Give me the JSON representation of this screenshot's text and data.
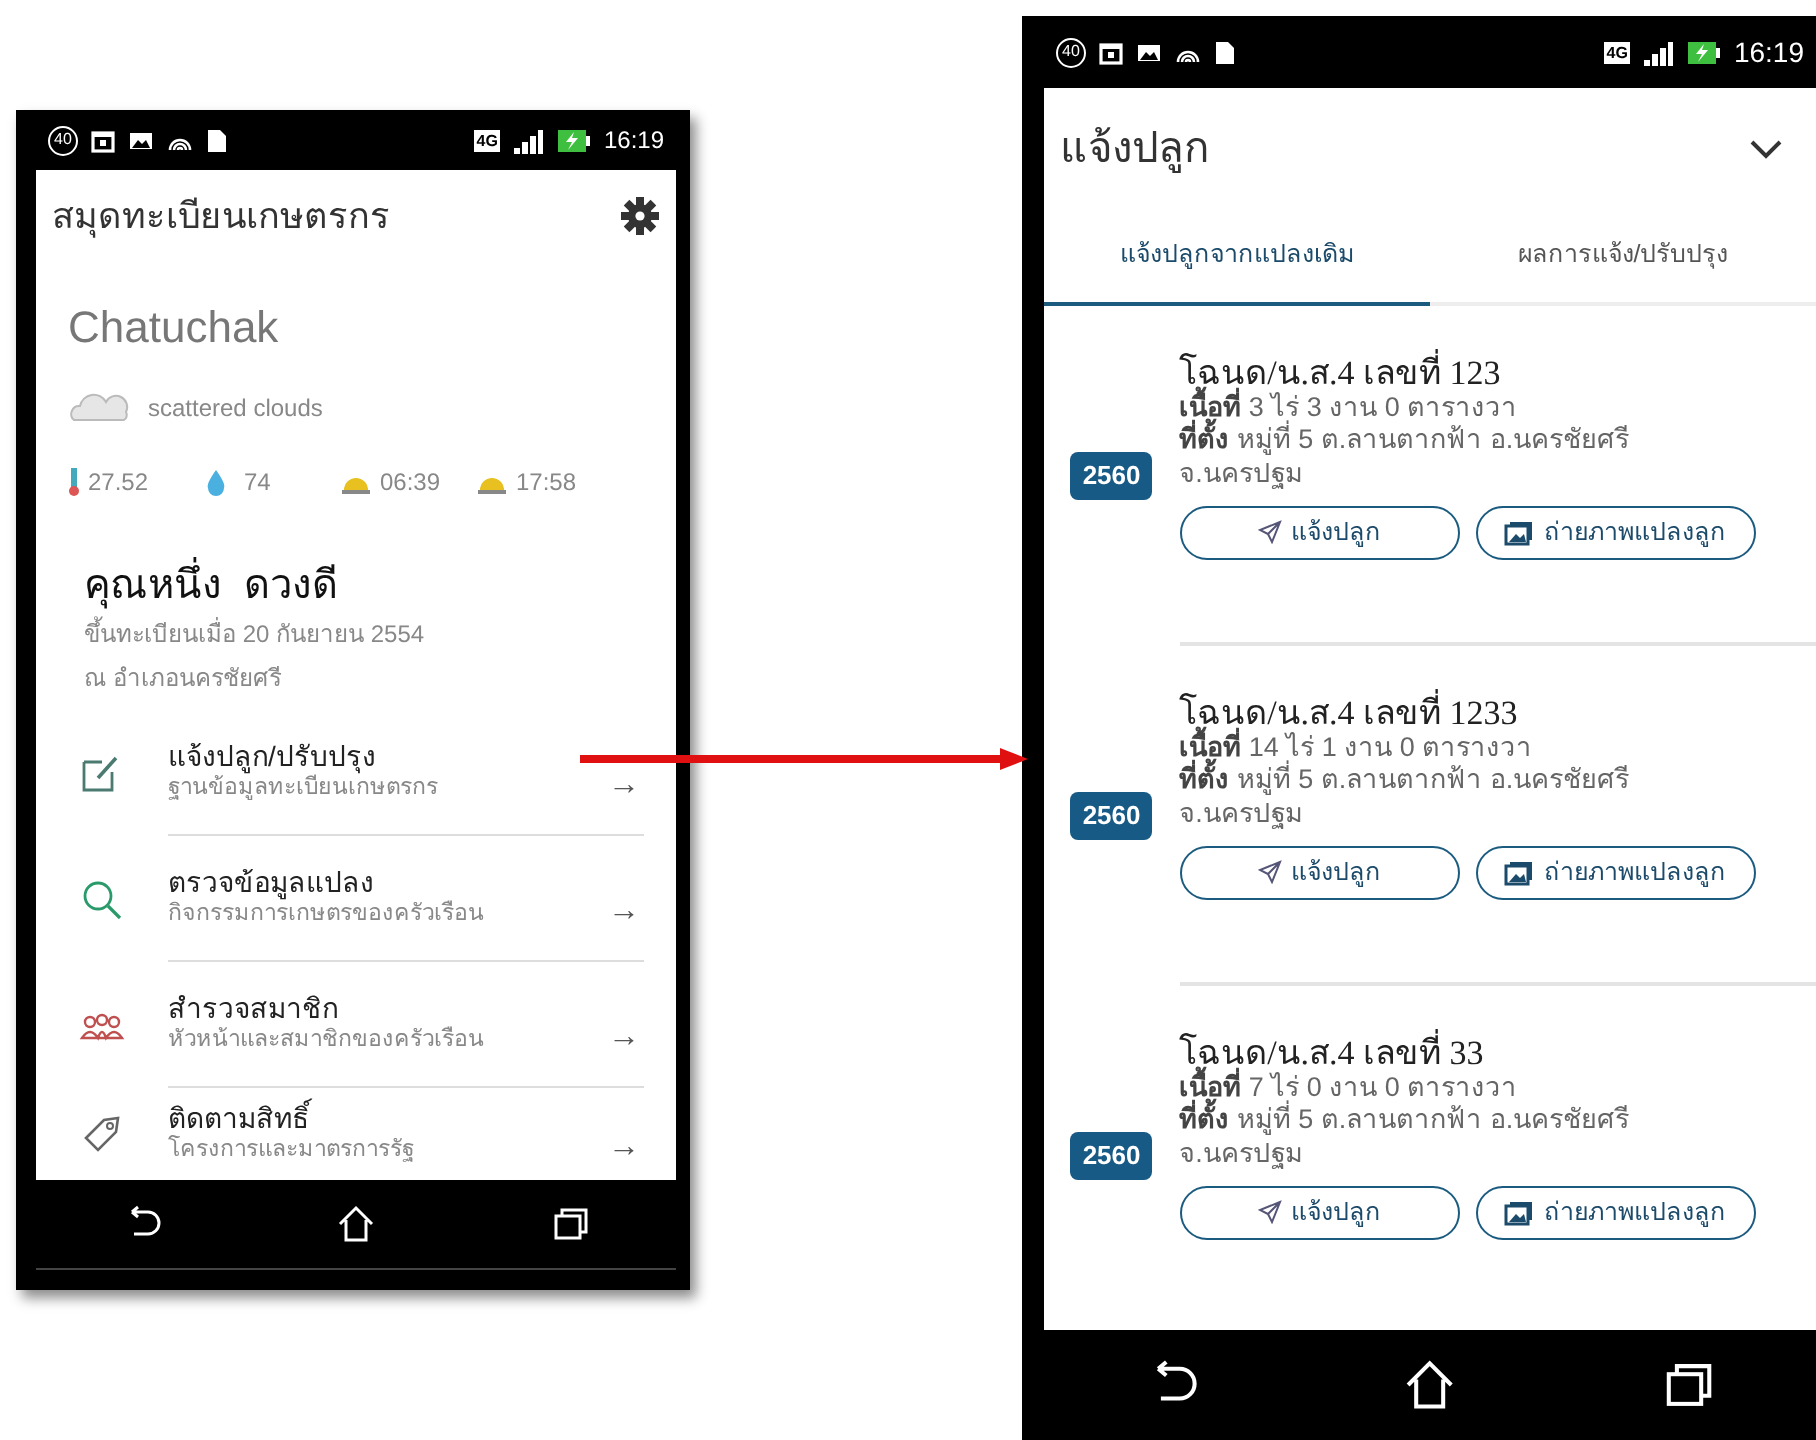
{
  "home_screen": {
    "status_bar": {
      "notification_count": "40",
      "network": "4G",
      "time": "16:19"
    },
    "app_bar": {
      "title": "สมุดทะเบียนเกษตรกร"
    },
    "weather": {
      "city": "Chatuchak",
      "condition": "scattered clouds",
      "stats": [
        {
          "kind": "temperature",
          "value": "27.52"
        },
        {
          "kind": "humidity",
          "value": "74"
        },
        {
          "kind": "sunrise",
          "value": "06:39"
        },
        {
          "kind": "sunset",
          "value": "17:58"
        }
      ]
    },
    "profile": {
      "name": "คุณหนึ่ง  ดวงดี",
      "registered": "ขึ้นทะเบียนเมื่อ 20 กันยายน 2554",
      "district": "ณ อำเภอนครชัยศรี"
    },
    "menu": [
      {
        "kind": "edit",
        "title": "แจ้งปลูก/ปรับปรุง",
        "subtitle": "ฐานข้อมูลทะเบียนเกษตรกร",
        "arrow": "→"
      },
      {
        "kind": "search",
        "title": "ตรวจข้อมูลแปลง",
        "subtitle": "กิจกรรมการเกษตรของครัวเรือน",
        "arrow": "→"
      },
      {
        "kind": "people",
        "title": "สำรวจสมาชิก",
        "subtitle": "หัวหน้าและสมาชิกของครัวเรือน",
        "arrow": "→"
      },
      {
        "kind": "tag",
        "title": "ติดตามสิทธิ์",
        "subtitle": "โครงการและมาตรการรัฐ",
        "arrow": "→"
      }
    ]
  },
  "planting_screen": {
    "status_bar": {
      "notification_count": "40",
      "network": "4G",
      "time": "16:19"
    },
    "app_bar": {
      "title": "แจ้งปลูก"
    },
    "tabs": [
      {
        "label": "แจ้งปลูกจากแปลงเดิม",
        "selected": true
      },
      {
        "label": "ผลการแจ้ง/ปรับปรุง",
        "selected": false
      }
    ],
    "plots": [
      {
        "title": "โฉนด/น.ส.4 เลขที่ 123",
        "area": "**เนื้อที่** 3 ไร่ 3 งาน 0 ตารางวา",
        "location": "**ที่ตั้ง** หมู่ที่ 5 ต.ลานตากฟ้า อ.นครชัยศรี จ.นครปฐม",
        "year": "2560",
        "buttons": [
          {
            "kind": "send",
            "label": "แจ้งปลูก"
          },
          {
            "kind": "photo",
            "label": "ถ่ายภาพแปลงลูก"
          }
        ]
      },
      {
        "title": "โฉนด/น.ส.4 เลขที่ 1233",
        "area": "**เนื้อที่** 14 ไร่ 1 งาน 0 ตารางวา",
        "location": "**ที่ตั้ง** หมู่ที่ 5 ต.ลานตากฟ้า อ.นครชัยศรี จ.นครปฐม",
        "year": "2560",
        "buttons": [
          {
            "kind": "send",
            "label": "แจ้งปลูก"
          },
          {
            "kind": "photo",
            "label": "ถ่ายภาพแปลงลูก"
          }
        ]
      },
      {
        "title": "โฉนด/น.ส.4 เลขที่ 33",
        "area": "**เนื้อที่** 7 ไร่ 0 งาน 0 ตารางวา",
        "location": "**ที่ตั้ง** หมู่ที่ 5 ต.ลานตากฟ้า อ.นครชัยศรี จ.นครปฐม",
        "year": "2560",
        "buttons": [
          {
            "kind": "send",
            "label": "แจ้งปลูก"
          },
          {
            "kind": "photo",
            "label": "ถ่ายภาพแปลงลูก"
          }
        ]
      }
    ]
  }
}
